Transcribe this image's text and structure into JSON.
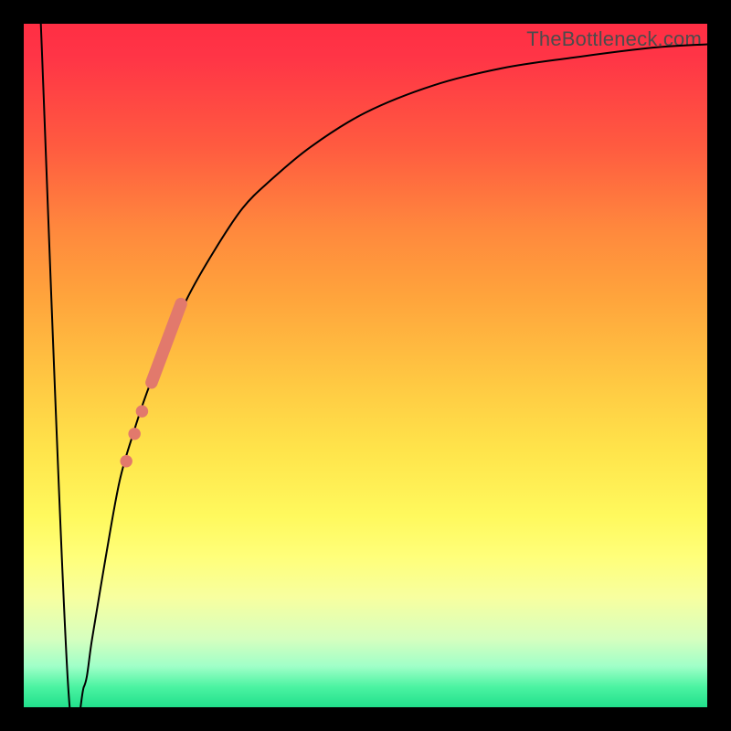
{
  "watermark": "TheBottleneck.com",
  "chart_data": {
    "type": "line",
    "title": "",
    "xlabel": "",
    "ylabel": "",
    "xlim": [
      0,
      100
    ],
    "ylim": [
      0,
      100
    ],
    "grid": false,
    "legend": false,
    "series": [
      {
        "name": "bottleneck-curve",
        "color": "#000000",
        "points_xy_pct": [
          [
            2.5,
            100
          ],
          [
            6.5,
            3
          ],
          [
            8.8,
            3
          ],
          [
            10,
            10
          ],
          [
            12,
            22
          ],
          [
            14,
            33
          ],
          [
            16,
            40
          ],
          [
            18,
            46
          ],
          [
            20,
            51
          ],
          [
            24,
            60
          ],
          [
            28,
            67
          ],
          [
            32,
            73
          ],
          [
            36,
            77
          ],
          [
            42,
            82
          ],
          [
            50,
            87
          ],
          [
            60,
            91
          ],
          [
            70,
            93.5
          ],
          [
            80,
            95
          ],
          [
            92,
            96.5
          ],
          [
            100,
            97
          ]
        ]
      }
    ],
    "markers": {
      "name": "highlight-segment",
      "color": "#e2796c",
      "line_segment_xy_pct": {
        "x1": 18.7,
        "y1": 47.5,
        "x2": 23,
        "y2": 59
      },
      "dots_xy_pct": [
        [
          17.3,
          43.3
        ],
        [
          16.2,
          40.0
        ],
        [
          15.0,
          36.0
        ]
      ],
      "dot_radius_pct": 0.9,
      "line_width_pct": 1.8
    }
  }
}
